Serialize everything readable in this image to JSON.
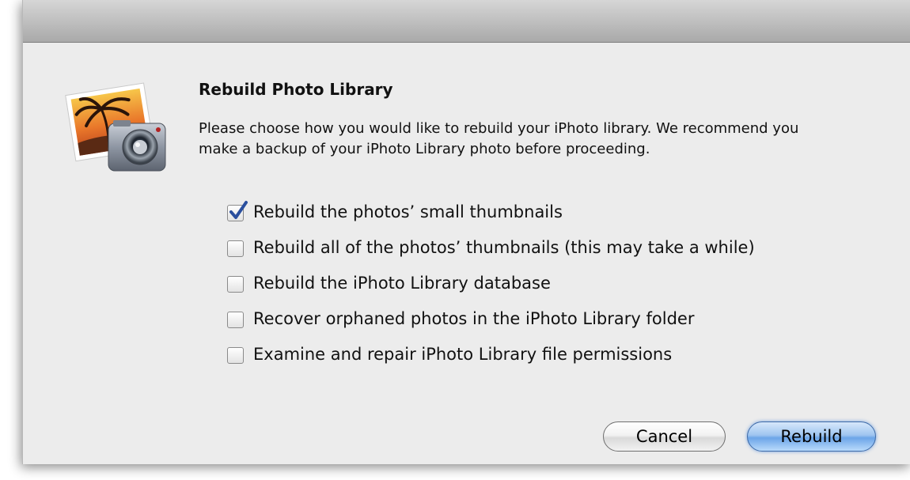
{
  "dialog": {
    "title": "Rebuild Photo Library",
    "message": "Please choose how you would like to rebuild your iPhoto library. We recommend you make a backup of your iPhoto Library photo before proceeding.",
    "icon": "iphoto-app-icon"
  },
  "options": [
    {
      "label": "Rebuild the photos’ small thumbnails",
      "checked": true
    },
    {
      "label": "Rebuild all of the photos’ thumbnails (this may take a while)",
      "checked": false
    },
    {
      "label": "Rebuild the iPhoto Library database",
      "checked": false
    },
    {
      "label": "Recover orphaned photos in the iPhoto Library folder",
      "checked": false
    },
    {
      "label": "Examine and repair iPhoto Library file permissions",
      "checked": false
    }
  ],
  "buttons": {
    "cancel_label": "Cancel",
    "rebuild_label": "Rebuild"
  },
  "colors": {
    "sheet_background": "#ececec",
    "default_button": "#6ca5e8",
    "checkmark": "#2a4f9e"
  }
}
